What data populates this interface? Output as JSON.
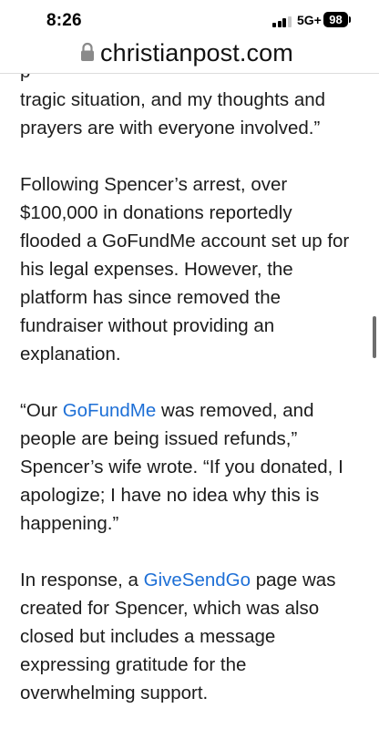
{
  "status_bar": {
    "time": "8:26",
    "network": "5G+",
    "battery_level": "98",
    "signal_bars_active": 3,
    "signal_bars_total": 4
  },
  "address_bar": {
    "url": "christianpost.com",
    "secure_icon": "lock-icon"
  },
  "article": {
    "partial_top_line": "p                              ",
    "paragraph_1": "tragic situation, and my thoughts and\nprayers are with everyone involved.”",
    "paragraph_2": "Following Spencer’s arrest, over\n$100,000 in donations reportedly\nflooded a GoFundMe account set up for\nhis legal expenses. However, the\nplatform has since removed the\nfundraiser without providing an\nexplanation.",
    "paragraph_3": {
      "before_link": "“Our ",
      "link_text": "GoFundMe",
      "after_link": " was removed, and\npeople are being issued refunds,”\nSpencer’s wife wrote. “If you donated, I\napologize; I have no idea why this is\nhappening.”"
    },
    "paragraph_4": {
      "before_link": "In response, a ",
      "link_text": "GiveSendGo",
      "after_link": " page was\ncreated for Spencer, which was also\nclosed but includes a message\nexpressing gratitude for the\noverwhelming support."
    }
  },
  "colors": {
    "link": "#1d6fd6",
    "text": "#1c1c1c",
    "signal_active": "#000000",
    "signal_inactive": "#c7c7c7"
  }
}
